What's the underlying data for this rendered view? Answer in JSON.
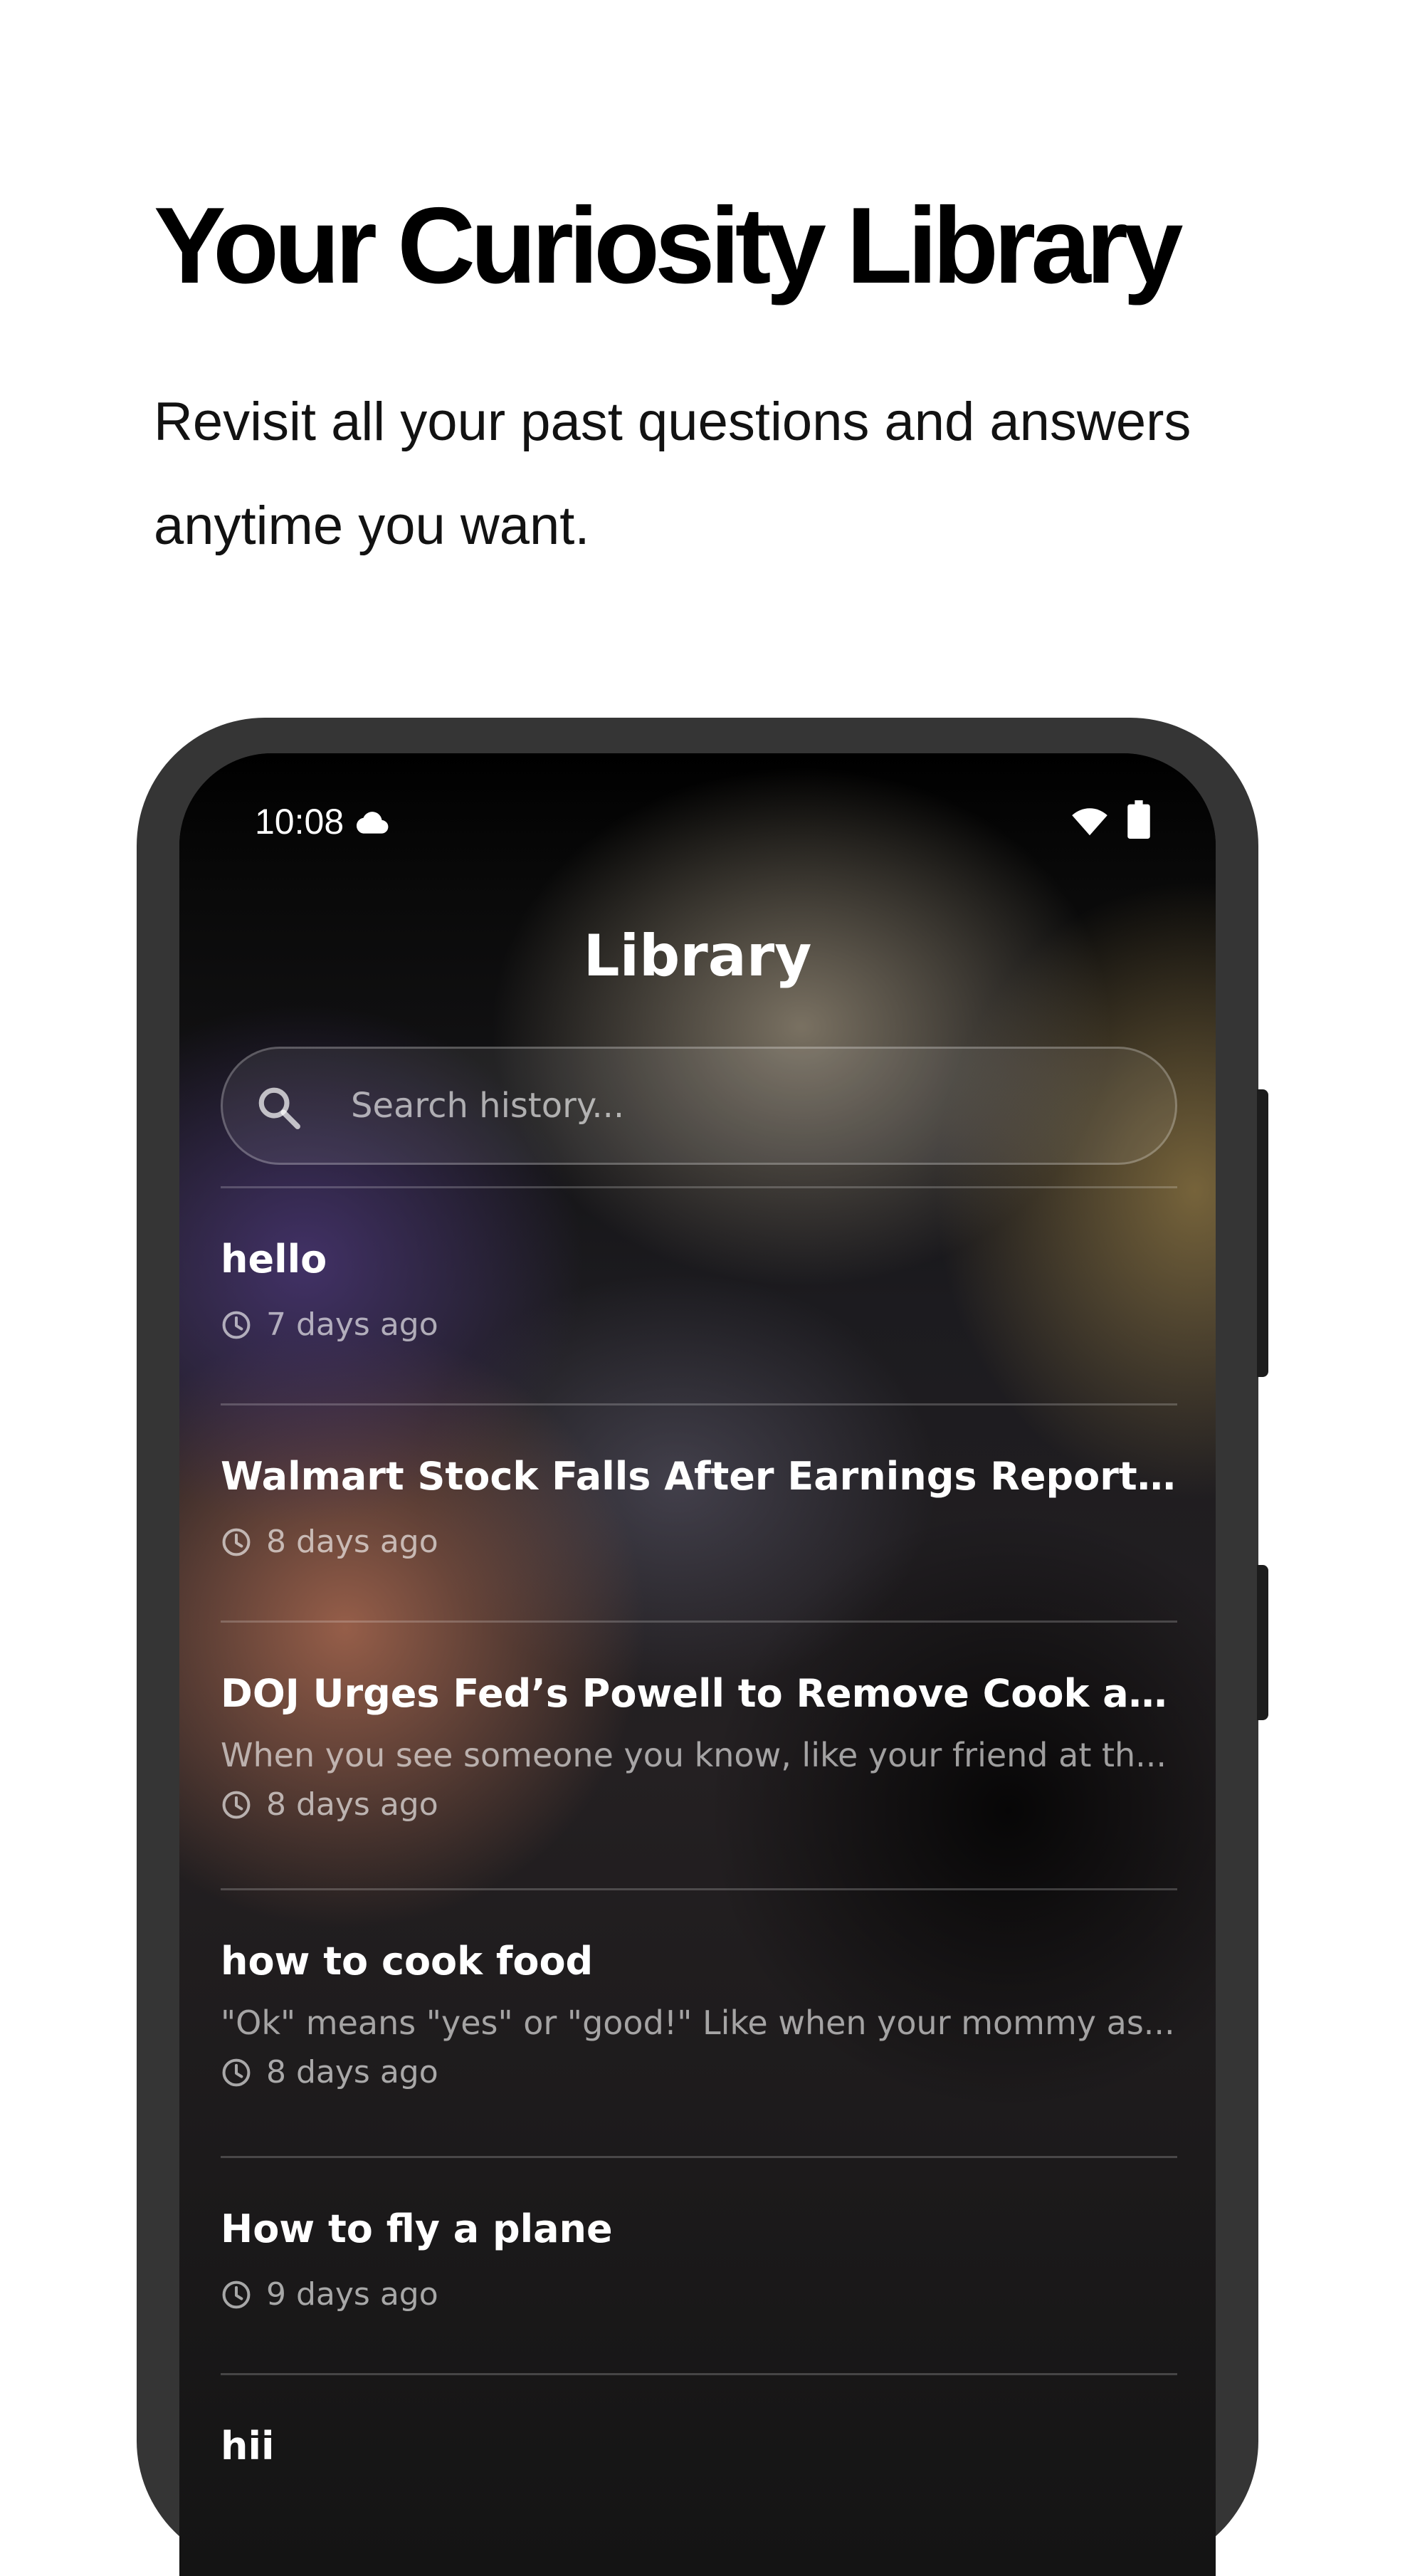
{
  "promo": {
    "title": "Your Curiosity Library",
    "subtitle": "Revisit all your past questions and answers anytime you want."
  },
  "status_bar": {
    "time": "10:08",
    "icons": [
      "cloud-icon",
      "wifi-icon",
      "battery-icon"
    ]
  },
  "library": {
    "title": "Library",
    "search": {
      "placeholder": "Search history...",
      "value": "",
      "icon": "search-icon"
    },
    "items": [
      {
        "title": "hello",
        "preview": "",
        "time": "7 days ago"
      },
      {
        "title": "Walmart Stock Falls After Earnings Report. He...",
        "preview": "",
        "time": "8 days ago"
      },
      {
        "title": "DOJ Urges Fed’s Powell to Remove Cook as Pr...",
        "preview": "When you see someone you know, like your friend at th...",
        "time": "8 days ago"
      },
      {
        "title": "how to cook food",
        "preview": "\"Ok\" means \"yes\" or \"good!\" Like when your mommy as...",
        "time": "8 days ago"
      },
      {
        "title": "How to fly a plane",
        "preview": "",
        "time": "9 days ago"
      },
      {
        "title": "hii",
        "preview": "",
        "time": ""
      }
    ]
  },
  "colors": {
    "page_background": "#ffffff",
    "phone_frame": "#353535",
    "screen_text": "#ffffff"
  }
}
